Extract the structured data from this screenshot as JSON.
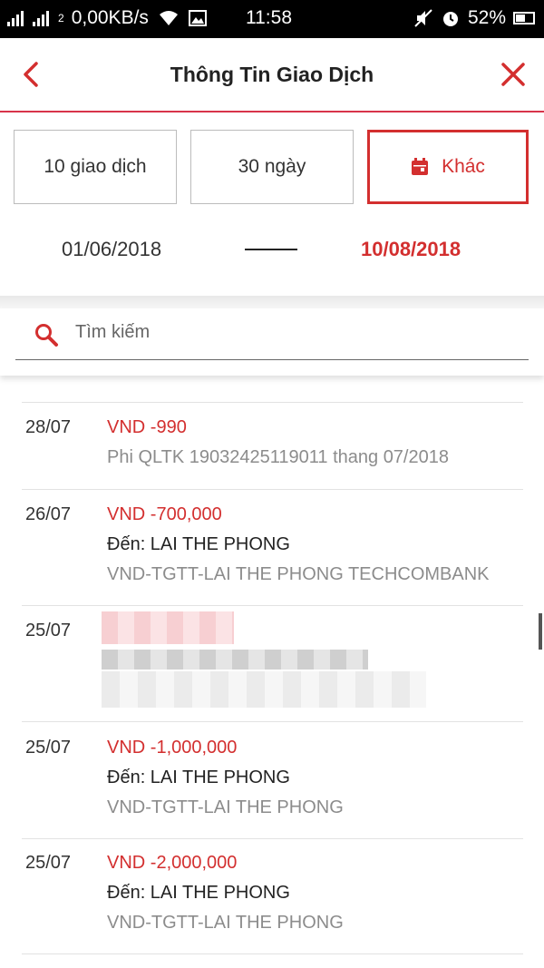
{
  "status_bar": {
    "sim_label": "2",
    "speed": "0,00KB/s",
    "time": "11:58",
    "battery": "52%"
  },
  "header": {
    "title": "Thông Tin Giao Dịch"
  },
  "filters": {
    "last_transactions": "10 giao dịch",
    "last_days": "30 ngày",
    "other": "Khác"
  },
  "date_range": {
    "from": "01/06/2018",
    "to": "10/08/2018"
  },
  "search": {
    "placeholder": "Tìm kiếm"
  },
  "transactions": [
    {
      "date": "28/07",
      "amount": "VND -990",
      "to": "",
      "description": "Phi QLTK 19032425119011 thang 07/2018"
    },
    {
      "date": "26/07",
      "amount": "VND -700,000",
      "to": "Đến: LAI THE PHONG",
      "description": "VND-TGTT-LAI THE PHONG TECHCOMBANK"
    },
    {
      "date": "25/07",
      "amount": "",
      "to": "",
      "description": ""
    },
    {
      "date": "25/07",
      "amount": "VND -1,000,000",
      "to": "Đến: LAI THE PHONG",
      "description": "VND-TGTT-LAI THE PHONG"
    },
    {
      "date": "25/07",
      "amount": "VND -2,000,000",
      "to": "Đến: LAI THE PHONG",
      "description": "VND-TGTT-LAI THE PHONG"
    }
  ],
  "colors": {
    "accent": "#d32f2f",
    "header_border": "#d8344a"
  }
}
